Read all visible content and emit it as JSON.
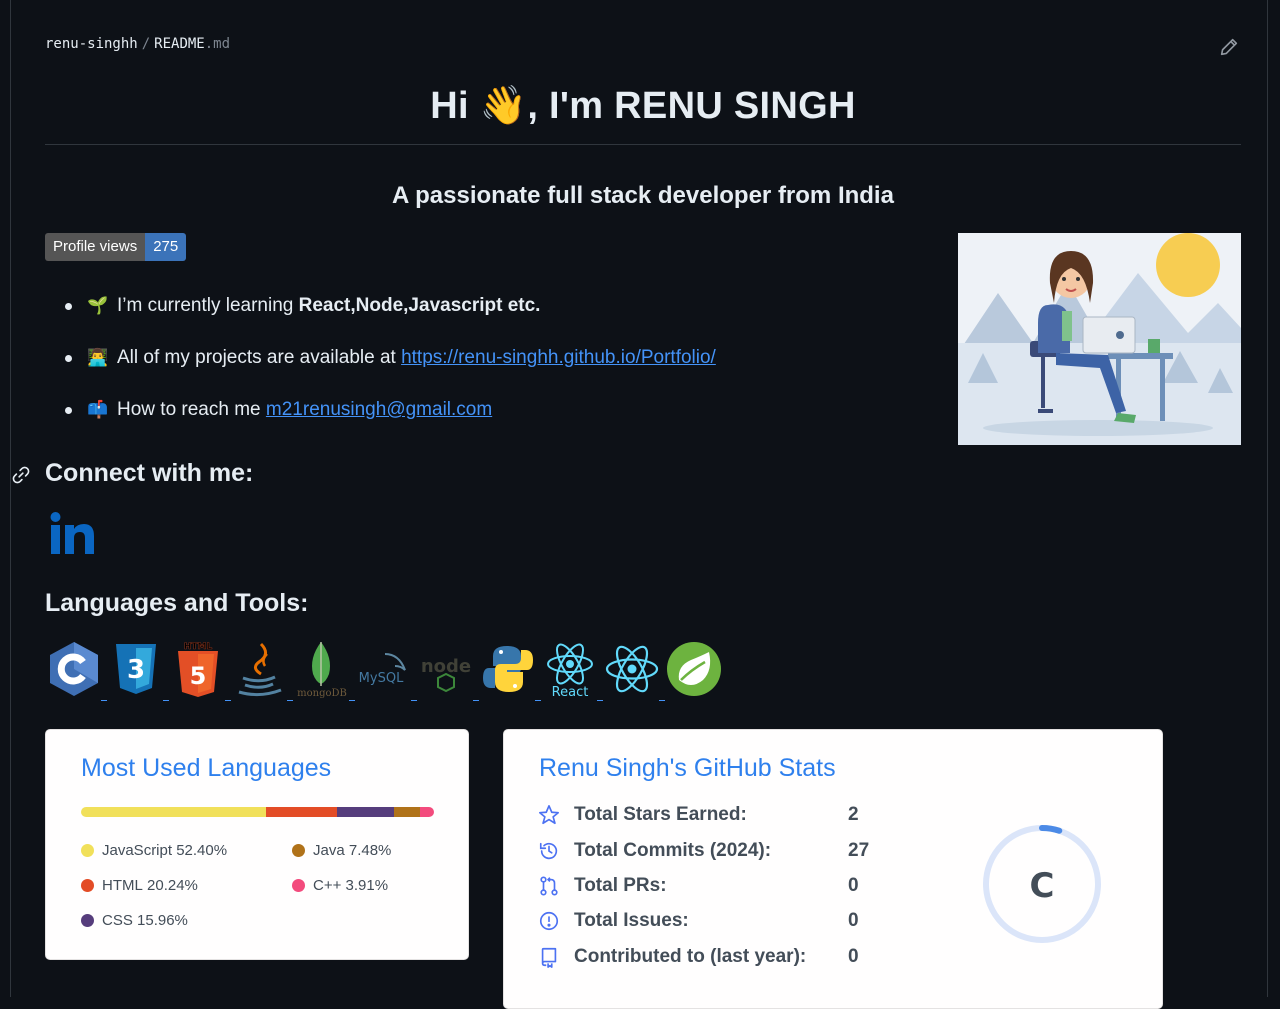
{
  "file_path": {
    "owner": "renu-singhh",
    "separator": "/",
    "file": "README",
    "ext": ".md"
  },
  "readme": {
    "title_pre": "Hi ",
    "title_emoji": "👋",
    "title_post": ", I'm RENU SINGH",
    "subtitle": "A passionate full stack developer from India",
    "badge": {
      "label": "Profile views",
      "count": "275"
    },
    "bullets": [
      {
        "emoji": "🌱",
        "text": "I’m currently learning ",
        "bold": "React,Node,Javascript etc."
      },
      {
        "emoji": "👨‍💻",
        "text": "All of my projects are available at ",
        "link": "https://renu-singhh.github.io/Portfolio/"
      },
      {
        "emoji": "📫",
        "text": "How to reach me ",
        "link": "m21renusingh@gmail.com"
      }
    ],
    "connect_heading": "Connect with me:",
    "linkedin_text": "in",
    "languages_heading": "Languages and Tools:",
    "tool_icons": [
      "c",
      "css3",
      "html5",
      "java",
      "mongodb",
      "mysql",
      "nodejs",
      "python",
      "react",
      "react",
      "spring"
    ],
    "icon_text": {
      "html": "HTML",
      "mongo": "mongoDB",
      "mysql": "MySQL",
      "node": "node",
      "react": "React"
    }
  },
  "languages_card": {
    "title": "Most Used Languages",
    "languages": [
      {
        "name": "JavaScript",
        "percent": 52.4,
        "label": "52.40%",
        "color": "#f1e05a"
      },
      {
        "name": "HTML",
        "percent": 20.24,
        "label": "20.24%",
        "color": "#e34c26"
      },
      {
        "name": "CSS",
        "percent": 15.96,
        "label": "15.96%",
        "color": "#563d7c"
      },
      {
        "name": "Java",
        "percent": 7.48,
        "label": "7.48%",
        "color": "#b07219"
      },
      {
        "name": "C++",
        "percent": 3.91,
        "label": "3.91%",
        "color": "#f34b7d"
      }
    ]
  },
  "stats_card": {
    "title": "Renu Singh's GitHub Stats",
    "stats": [
      {
        "icon": "star-icon",
        "label": "Total Stars Earned:",
        "value": "2"
      },
      {
        "icon": "history-icon",
        "label": "Total Commits (2024):",
        "value": "27"
      },
      {
        "icon": "pull-request-icon",
        "label": "Total PRs:",
        "value": "0"
      },
      {
        "icon": "issue-icon",
        "label": "Total Issues:",
        "value": "0"
      },
      {
        "icon": "repo-icon",
        "label": "Contributed to (last year):",
        "value": "0"
      }
    ],
    "grade": "C",
    "grade_progress": 0.05
  }
}
